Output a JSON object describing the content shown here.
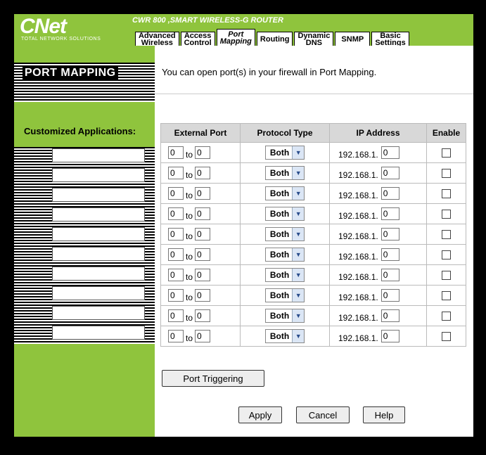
{
  "brand": {
    "logo_text": "CNet",
    "logo_sub": "TOTAL NETWORK SOLUTIONS",
    "product": "CWR 800 ,SMART WIRELESS-G ROUTER"
  },
  "tabs": [
    {
      "label": "Advanced Wireless",
      "l1": "Advanced",
      "l2": "Wireless"
    },
    {
      "label": "Access Control",
      "l1": "Access",
      "l2": "Control"
    },
    {
      "label": "Port Mapping",
      "l1": "Port",
      "l2": "Mapping"
    },
    {
      "label": "Routing",
      "l1": "Routing",
      "l2": ""
    },
    {
      "label": "Dynamic DNS",
      "l1": "Dynamic",
      "l2": "DNS"
    },
    {
      "label": "SNMP",
      "l1": "SNMP",
      "l2": ""
    },
    {
      "label": "Basic Settings",
      "l1": "Basic",
      "l2": "Settings"
    }
  ],
  "active_tab": "Port Mapping",
  "left": {
    "title": "PORT MAPPING",
    "custom_label": "Customized Applications:"
  },
  "intro": "You can open port(s) in your firewall in Port Mapping.",
  "table": {
    "headers": [
      "External Port",
      "Protocol Type",
      "IP Address",
      "Enable"
    ],
    "to_label": "to",
    "ip_prefix": "192.168.1.",
    "rows": [
      {
        "app": "",
        "from": "0",
        "to": "0",
        "protocol": "Both",
        "ip": "0",
        "enabled": false
      },
      {
        "app": "",
        "from": "0",
        "to": "0",
        "protocol": "Both",
        "ip": "0",
        "enabled": false
      },
      {
        "app": "",
        "from": "0",
        "to": "0",
        "protocol": "Both",
        "ip": "0",
        "enabled": false
      },
      {
        "app": "",
        "from": "0",
        "to": "0",
        "protocol": "Both",
        "ip": "0",
        "enabled": false
      },
      {
        "app": "",
        "from": "0",
        "to": "0",
        "protocol": "Both",
        "ip": "0",
        "enabled": false
      },
      {
        "app": "",
        "from": "0",
        "to": "0",
        "protocol": "Both",
        "ip": "0",
        "enabled": false
      },
      {
        "app": "",
        "from": "0",
        "to": "0",
        "protocol": "Both",
        "ip": "0",
        "enabled": false
      },
      {
        "app": "",
        "from": "0",
        "to": "0",
        "protocol": "Both",
        "ip": "0",
        "enabled": false
      },
      {
        "app": "",
        "from": "0",
        "to": "0",
        "protocol": "Both",
        "ip": "0",
        "enabled": false
      },
      {
        "app": "",
        "from": "0",
        "to": "0",
        "protocol": "Both",
        "ip": "0",
        "enabled": false
      }
    ]
  },
  "buttons": {
    "port_triggering": "Port Triggering",
    "apply": "Apply",
    "cancel": "Cancel",
    "help": "Help"
  },
  "colors": {
    "accent_green": "#8fc43d",
    "background": "#000000",
    "table_header": "#d8d8d8"
  }
}
